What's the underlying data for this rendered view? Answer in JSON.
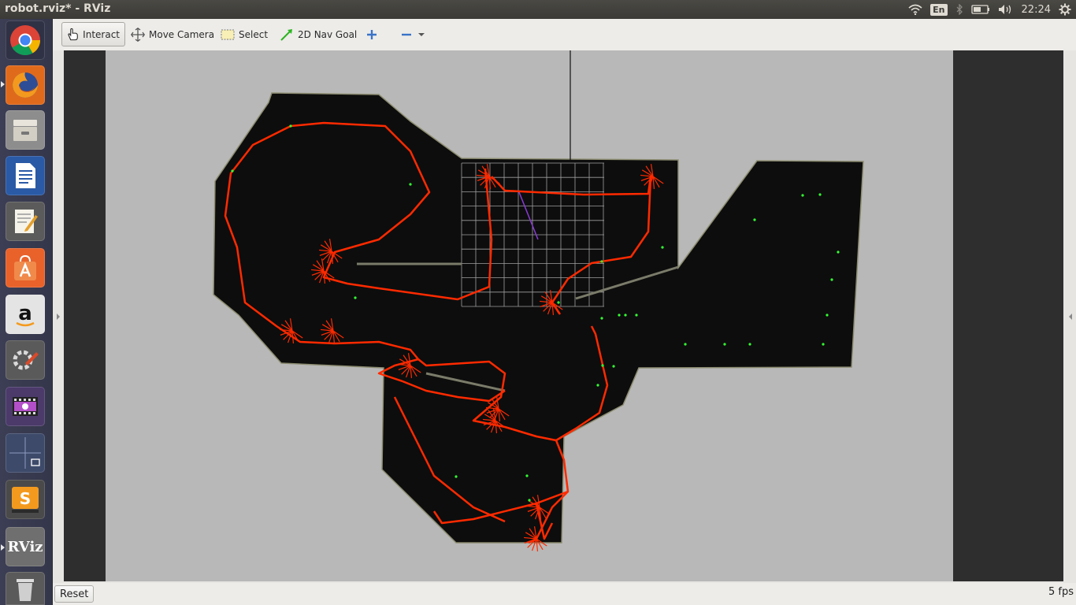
{
  "window": {
    "title": "robot.rviz* - RViz"
  },
  "tray": {
    "language": "En",
    "clock": "22:24"
  },
  "launcher": {
    "items": [
      {
        "icon": "chrome-icon"
      },
      {
        "icon": "firefox-icon"
      },
      {
        "icon": "files-icon"
      },
      {
        "icon": "writer-icon"
      },
      {
        "icon": "text-editor-icon"
      },
      {
        "icon": "software-center-icon"
      },
      {
        "icon": "amazon-icon"
      },
      {
        "icon": "system-settings-icon"
      },
      {
        "icon": "video-icon"
      },
      {
        "icon": "workspace-switcher-icon"
      },
      {
        "icon": "sublime-text-icon"
      },
      {
        "icon": "rviz-icon",
        "label": "RViz"
      },
      {
        "icon": "trash-icon"
      }
    ]
  },
  "toolbar": {
    "interact": "Interact",
    "move_camera": "Move Camera",
    "select": "Select",
    "nav_goal": "2D Nav Goal"
  },
  "status": {
    "reset": "Reset",
    "fps": "5 fps"
  },
  "colors": {
    "path": "#ff2a00",
    "arrow": "#33ff33",
    "map_bg": "#0d0d0d",
    "view_bg": "#b8b8b8",
    "grid": "#a0a0a0"
  }
}
